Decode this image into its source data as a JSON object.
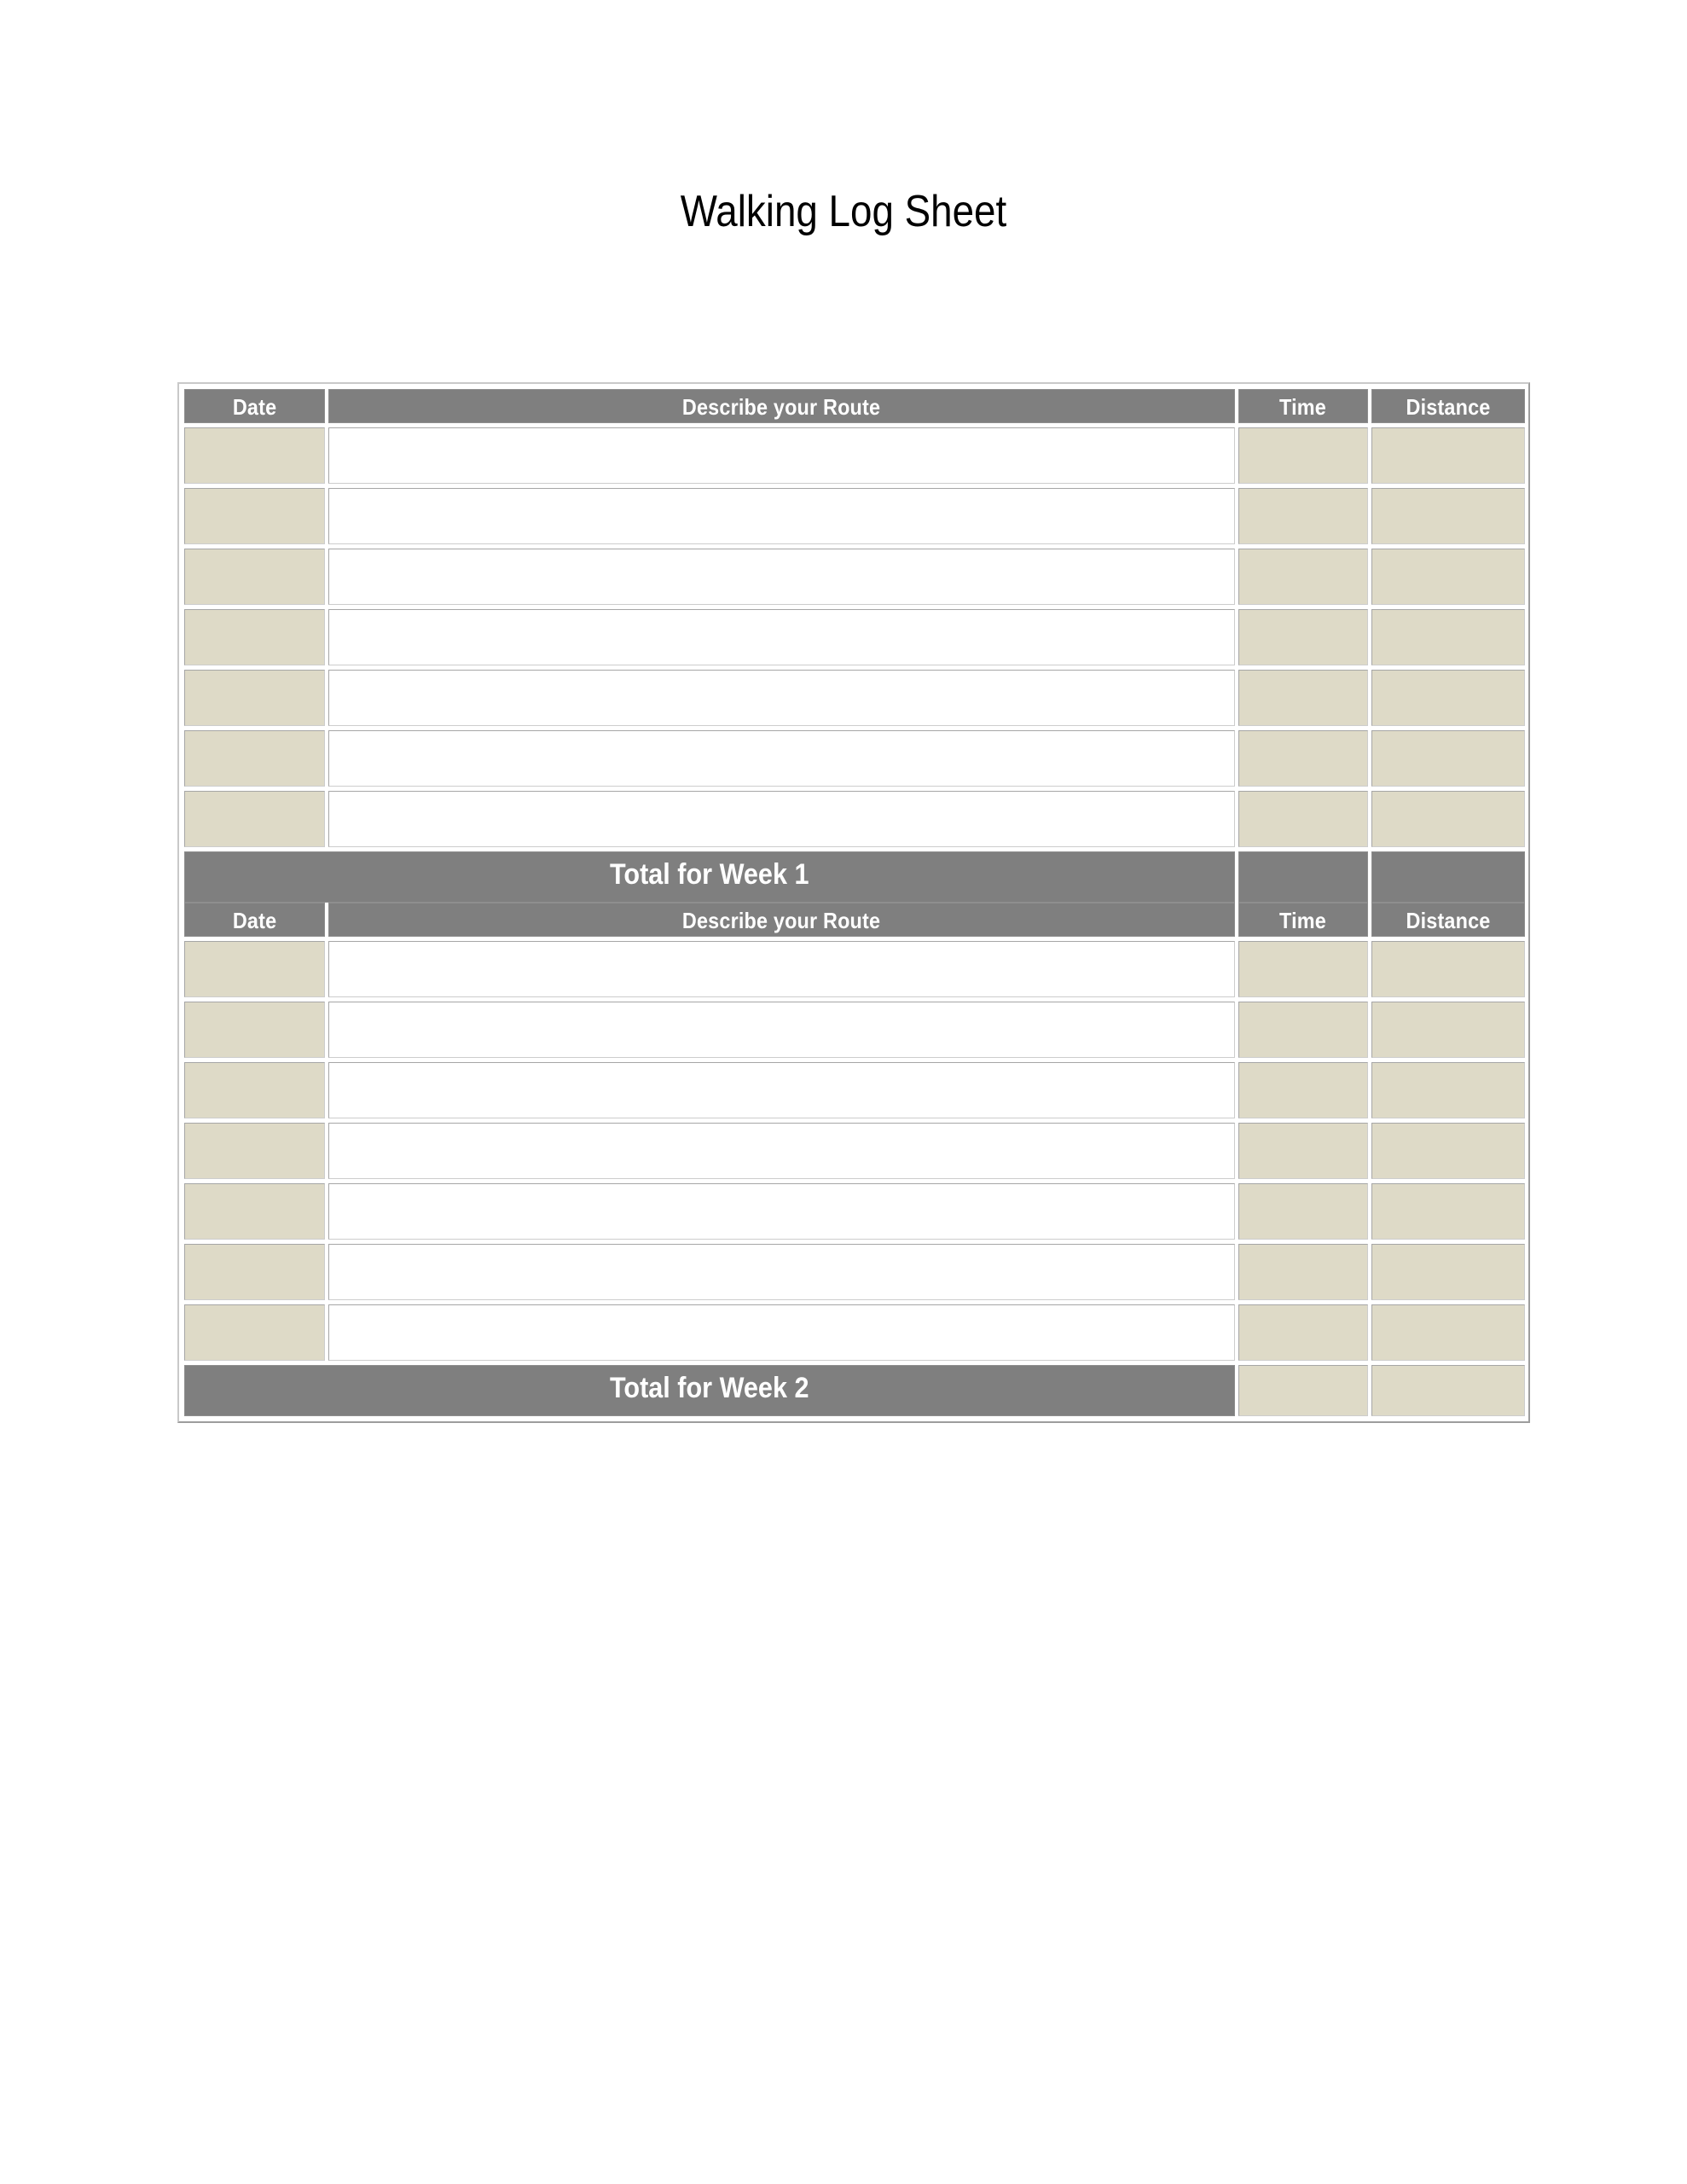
{
  "document": {
    "title": "Walking Log Sheet"
  },
  "colors": {
    "header_gray": "#7f7f7f",
    "cell_beige": "#dedac7",
    "cell_white": "#ffffff",
    "frame_border": "#c9c9c9",
    "cell_border": "#a6a6a6",
    "header_text": "#ffffff",
    "title_text": "#000000"
  },
  "table": {
    "columns": [
      {
        "key": "date",
        "label": "Date"
      },
      {
        "key": "route",
        "label": "Describe your Route"
      },
      {
        "key": "time",
        "label": "Time"
      },
      {
        "key": "distance",
        "label": "Distance"
      }
    ],
    "sections": [
      {
        "id": "week-1",
        "headers": {
          "date": "Date",
          "route": "Describe your Route",
          "time": "Time",
          "distance": "Distance"
        },
        "rows": [
          {
            "date": "",
            "route": "",
            "time": "",
            "distance": ""
          },
          {
            "date": "",
            "route": "",
            "time": "",
            "distance": ""
          },
          {
            "date": "",
            "route": "",
            "time": "",
            "distance": ""
          },
          {
            "date": "",
            "route": "",
            "time": "",
            "distance": ""
          },
          {
            "date": "",
            "route": "",
            "time": "",
            "distance": ""
          },
          {
            "date": "",
            "route": "",
            "time": "",
            "distance": ""
          },
          {
            "date": "",
            "route": "",
            "time": "",
            "distance": ""
          }
        ],
        "total": {
          "label": "Total for Week 1",
          "time": "",
          "distance": "",
          "time_style": "gray",
          "distance_style": "gray"
        }
      },
      {
        "id": "week-2",
        "headers": {
          "date": "Date",
          "route": "Describe your Route",
          "time": "Time",
          "distance": "Distance"
        },
        "rows": [
          {
            "date": "",
            "route": "",
            "time": "",
            "distance": ""
          },
          {
            "date": "",
            "route": "",
            "time": "",
            "distance": ""
          },
          {
            "date": "",
            "route": "",
            "time": "",
            "distance": ""
          },
          {
            "date": "",
            "route": "",
            "time": "",
            "distance": ""
          },
          {
            "date": "",
            "route": "",
            "time": "",
            "distance": ""
          },
          {
            "date": "",
            "route": "",
            "time": "",
            "distance": ""
          },
          {
            "date": "",
            "route": "",
            "time": "",
            "distance": ""
          }
        ],
        "total": {
          "label": "Total for Week 2",
          "time": "",
          "distance": "",
          "time_style": "beige",
          "distance_style": "beige"
        }
      }
    ]
  }
}
